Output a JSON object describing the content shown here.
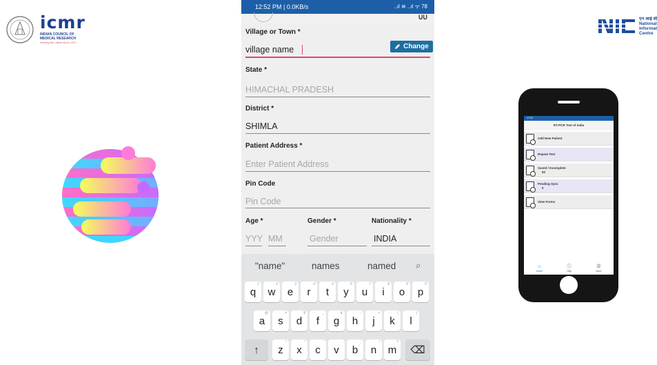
{
  "icmr": {
    "word": "icmr",
    "line1": "INDIAN COUNCIL OF",
    "line2": "MEDICAL RESEARCH",
    "tagline": "Serving the nation since 1911"
  },
  "nic": {
    "hindi": "एन आई सी",
    "line1": "National",
    "line2": "Informati",
    "line3": "Centre"
  },
  "statusbar": {
    "time": "12:52 PM | 0.0KB/s",
    "icons": "..ıl ≋ ..ıl ᯤ 78"
  },
  "topstrip": {
    "right": "ᑌᑌ"
  },
  "form": {
    "village_label": "Village or Town *",
    "village_value": "village name",
    "state_label": "State *",
    "change_label": "Change",
    "state_value": "HIMACHAL PRADESH",
    "district_label": "District *",
    "district_value": "SHIMLA",
    "address_label": "Patient Address *",
    "address_placeholder": "Enter Patient Address",
    "pin_label": "Pin Code",
    "pin_placeholder": "Pin Code",
    "age_label": "Age *",
    "gender_label": "Gender *",
    "nationality_label": "Nationality *",
    "age_yyy": "YYY",
    "age_mm": "MM",
    "gender_placeholder": "Gender",
    "nationality_value": "INDIA"
  },
  "keyboard": {
    "suggestions": [
      "\"name\"",
      "names",
      "named"
    ],
    "row1": [
      "q",
      "w",
      "e",
      "r",
      "t",
      "y",
      "u",
      "i",
      "o",
      "p"
    ],
    "row1_hints": [
      "1",
      "2",
      "3",
      "4",
      "5",
      "6",
      "7",
      "8",
      "9",
      "0"
    ],
    "row2": [
      "a",
      "s",
      "d",
      "f",
      "g",
      "h",
      "j",
      "k",
      "l"
    ],
    "row2_hints": [
      "@",
      "#",
      "$",
      "_",
      "&",
      "-",
      "+",
      "(",
      ")"
    ],
    "row3": [
      "z",
      "x",
      "c",
      "v",
      "b",
      "n",
      "m"
    ],
    "row3_hints": [
      "*",
      "\"",
      "'",
      ":",
      ";",
      "!",
      "?"
    ],
    "shift": "↑",
    "backspace": "⌫"
  },
  "mini_phone": {
    "status": "17:24",
    "title": "RT-PCR Test of India",
    "items": [
      {
        "label": "Add New Patient",
        "count": ""
      },
      {
        "label": "Repeat Test",
        "count": ""
      },
      {
        "label": "Saved / Incomplete",
        "count": "83"
      },
      {
        "label": "Pending Sync",
        "count": "0"
      },
      {
        "label": "View Forms",
        "count": ""
      }
    ],
    "nav": [
      "Home",
      "Help",
      "More"
    ]
  },
  "colors": {
    "status_blue": "#1c5fa8",
    "change_button": "#1c6fa1",
    "active_underline": "#d64a6b"
  }
}
